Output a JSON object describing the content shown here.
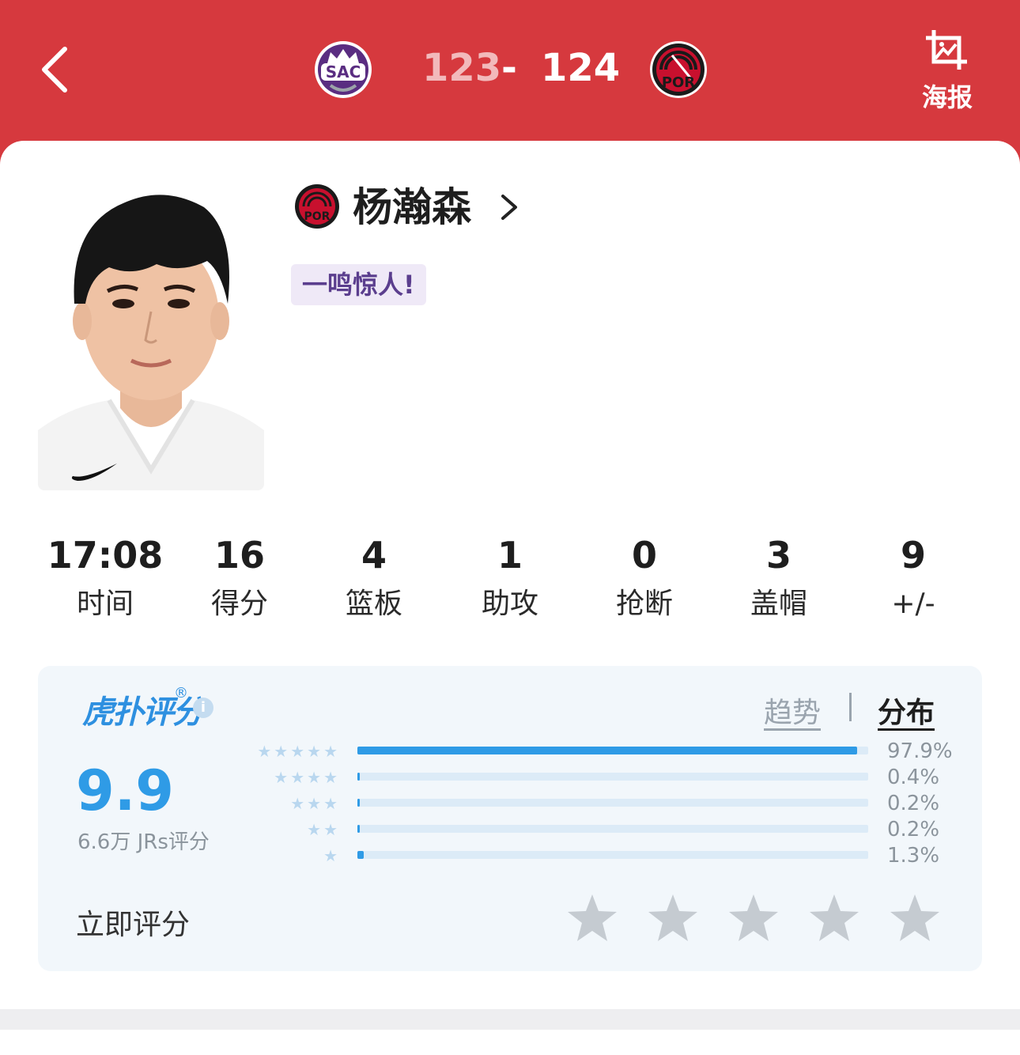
{
  "header": {
    "home_team": {
      "abbr": "SAC",
      "score": "123",
      "color": "#5a2d81"
    },
    "separator": "-",
    "away_team": {
      "abbr": "POR",
      "score": "124",
      "color": "#c8102e"
    },
    "poster_label": "海报"
  },
  "player": {
    "name": "杨瀚森",
    "tag": "一鸣惊人!"
  },
  "stats": [
    {
      "value": "17:08",
      "label": "时间"
    },
    {
      "value": "16",
      "label": "得分"
    },
    {
      "value": "4",
      "label": "篮板"
    },
    {
      "value": "1",
      "label": "助攻"
    },
    {
      "value": "0",
      "label": "抢断"
    },
    {
      "value": "3",
      "label": "盖帽"
    },
    {
      "value": "9",
      "label": "+/-"
    }
  ],
  "rating": {
    "brand": "虎扑评分",
    "registered": "®",
    "info_icon": "i",
    "tabs": {
      "trend": "趋势",
      "distribution": "分布"
    },
    "score": "9.9",
    "votes": "6.6万 JRs评分",
    "distribution": [
      {
        "stars": "★★★★★",
        "percent": "97.9%",
        "fraction": 0.979
      },
      {
        "stars": "★★★★",
        "percent": "0.4%",
        "fraction": 0.004
      },
      {
        "stars": "★★★",
        "percent": "0.2%",
        "fraction": 0.002
      },
      {
        "stars": "★★",
        "percent": "0.2%",
        "fraction": 0.002
      },
      {
        "stars": "★",
        "percent": "1.3%",
        "fraction": 0.013
      }
    ],
    "rate_now_label": "立即评分",
    "accent_color": "#2f9be6"
  }
}
